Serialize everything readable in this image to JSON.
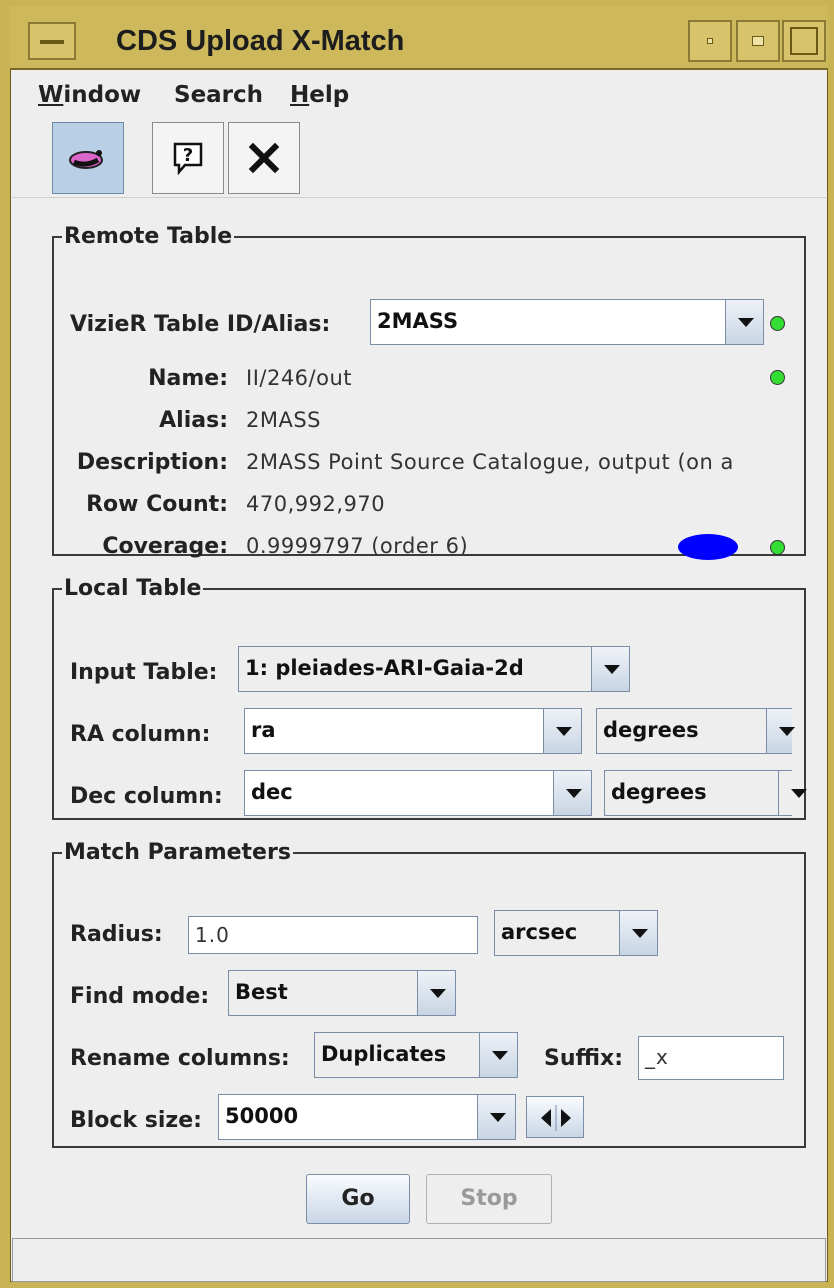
{
  "window": {
    "title": "CDS Upload X-Match"
  },
  "menu": [
    {
      "label": "Window"
    },
    {
      "label": "Search"
    },
    {
      "label": "Help"
    }
  ],
  "toolbar": {
    "tools": [
      {
        "icon": "plot-link-icon",
        "active": true
      },
      {
        "icon": "help-icon",
        "active": false
      },
      {
        "icon": "close-icon",
        "active": false
      }
    ]
  },
  "remote": {
    "legend": "Remote Table",
    "table_id_label": "VizieR Table ID/Alias:",
    "table_id_value": "2MASS",
    "name_label": "Name:",
    "name_value": "II/246/out",
    "alias_label": "Alias:",
    "alias_value": "2MASS",
    "desc_label": "Description:",
    "desc_value": "2MASS Point Source Catalogue, output (on a",
    "rowcount_label": "Row Count:",
    "rowcount_value": "470,992,970",
    "coverage_label": "Coverage:",
    "coverage_value": "0.9999797 (order 6)",
    "status_color": "#33dd33",
    "coverage_color": "#0000ff"
  },
  "local": {
    "legend": "Local Table",
    "input_label": "Input Table:",
    "input_value": "1: pleiades-ARI-Gaia-2d",
    "ra_label": "RA column:",
    "ra_value": "ra",
    "ra_unit": "degrees",
    "dec_label": "Dec column:",
    "dec_value": "dec",
    "dec_unit": "degrees"
  },
  "match": {
    "legend": "Match Parameters",
    "radius_label": "Radius:",
    "radius_value": "1.0",
    "radius_unit": "arcsec",
    "find_label": "Find mode:",
    "find_value": "Best",
    "rename_label": "Rename columns:",
    "rename_value": "Duplicates",
    "suffix_label": "Suffix:",
    "suffix_value": "_x",
    "block_label": "Block size:",
    "block_value": "50000"
  },
  "actions": {
    "go": "Go",
    "stop": "Stop"
  }
}
